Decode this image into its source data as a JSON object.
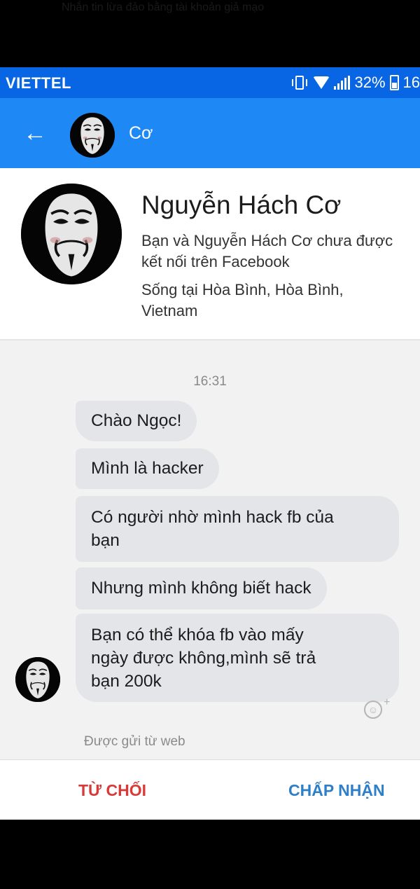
{
  "top_overlay_text": "Nhắn tin lừa đảo bằng tài khoản giả mạo",
  "status_bar": {
    "carrier": "VIETTEL",
    "battery": "32%",
    "time_partial": "16",
    "icons": [
      "vibrate-icon",
      "wifi-icon",
      "signal-icon",
      "battery-icon"
    ]
  },
  "header": {
    "back_icon": "back-arrow-icon",
    "contact_name": "Cơ"
  },
  "profile": {
    "full_name": "Nguyễn Hách Cơ",
    "connection_line1": "Bạn và Nguyễn Hách Cơ chưa được",
    "connection_line2": "kết nối trên Facebook",
    "location_line1": "Sống tại Hòa Bình, Hòa Bình,",
    "location_line2": "Vietnam"
  },
  "chat": {
    "timestamp": "16:31",
    "messages": [
      {
        "lines": [
          "Chào Ngọc!"
        ]
      },
      {
        "lines": [
          "Mình là hacker"
        ]
      },
      {
        "lines": [
          "Có người nhờ mình hack fb của",
          "bạn"
        ]
      },
      {
        "lines": [
          "Nhưng mình không biết hack"
        ]
      },
      {
        "lines": [
          "Bạn có thể khóa fb vào mấy",
          "ngày được không,mình sẽ trả",
          "bạn 200k"
        ]
      }
    ],
    "reaction_icon": "add-reaction-icon",
    "sent_from": "Được gửi từ web"
  },
  "actions": {
    "decline_label": "TỪ CHỐI",
    "accept_label": "CHẤP NHẬN"
  },
  "colors": {
    "status_bar": "#0866e4",
    "header": "#1e88f5",
    "bubble": "#e4e5e8",
    "decline": "#d83a3a",
    "accept": "#2d7fc9"
  }
}
